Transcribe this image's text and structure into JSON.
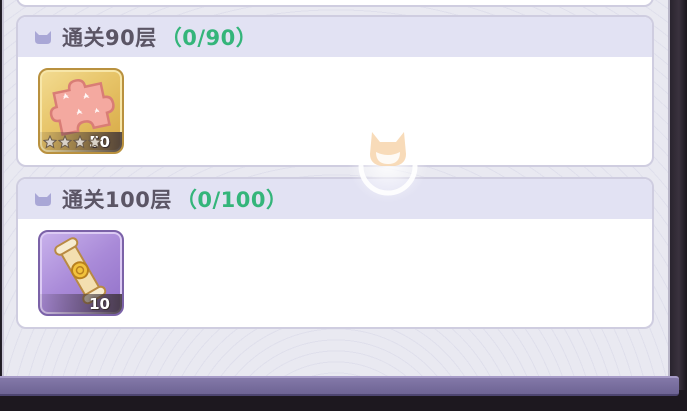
{
  "rewards": [
    {
      "title": "通关90层",
      "progress": "（0/90）",
      "item": {
        "icon": "puzzle-piece-icon",
        "count": "50",
        "frame": "gold",
        "stars": 4
      }
    },
    {
      "title": "通关100层",
      "progress": "（0/100）",
      "item": {
        "icon": "scroll-icon",
        "count": "10",
        "frame": "purple"
      }
    }
  ],
  "colors": {
    "progress_text": "#34b57a",
    "title_text": "#5b5565",
    "header_bg": "#e2e2f3",
    "panel_bar": "#7a6fa2"
  }
}
